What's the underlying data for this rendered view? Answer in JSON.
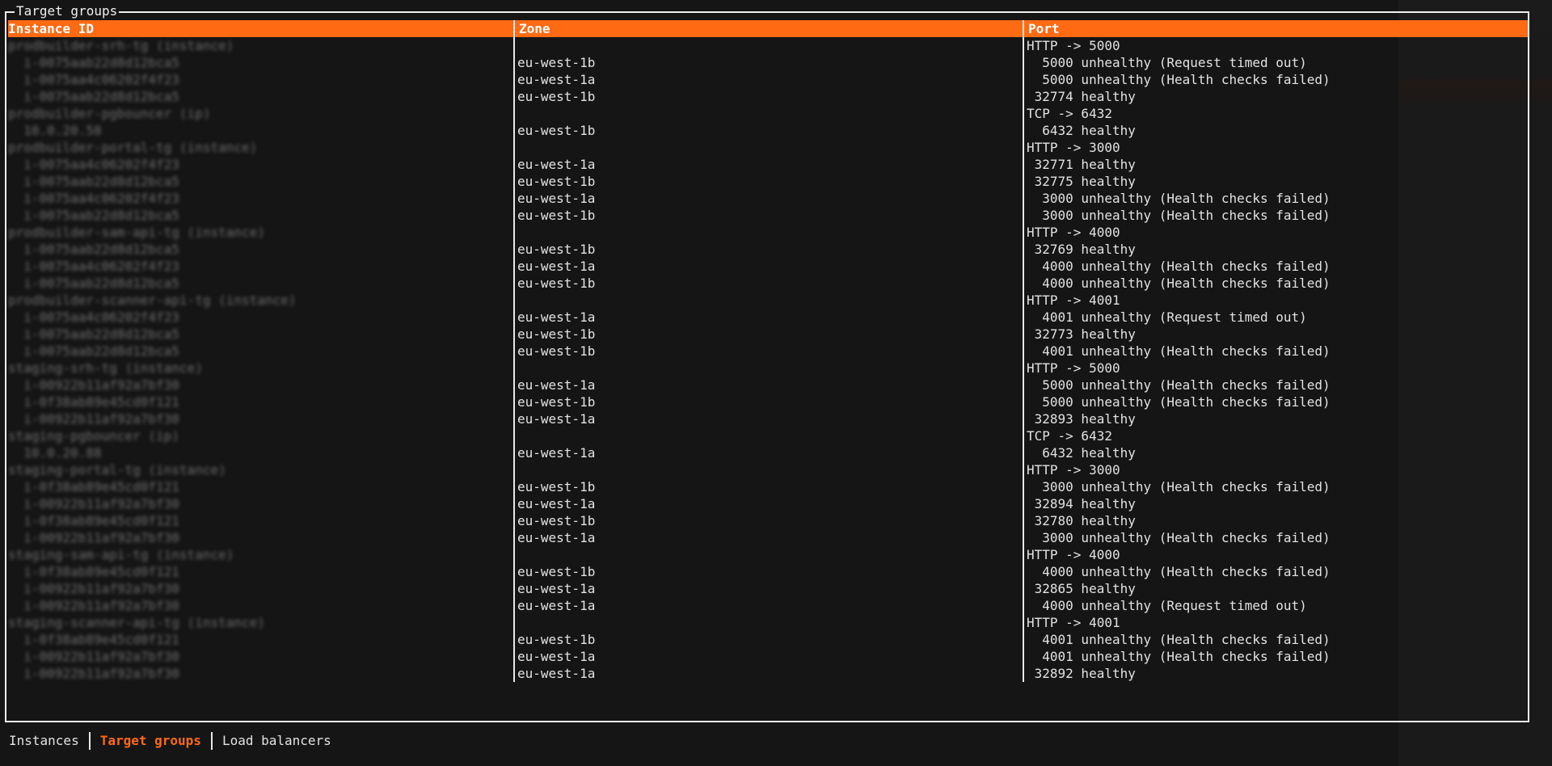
{
  "panel_title": "Target groups",
  "columns": [
    "Instance ID",
    "Zone",
    "Port"
  ],
  "rows": [
    {
      "instance": "prodbuilder-srh-tg (instance)",
      "zone": "",
      "port": "HTTP -> 5000"
    },
    {
      "instance": "  i-0075aab22d8d12bca5",
      "zone": "eu-west-1b",
      "port": "  5000 unhealthy (Request timed out)"
    },
    {
      "instance": "  i-0075aa4c06202f4f23",
      "zone": "eu-west-1a",
      "port": "  5000 unhealthy (Health checks failed)"
    },
    {
      "instance": "  i-0075aab22d8d12bca5",
      "zone": "eu-west-1b",
      "port": " 32774 healthy"
    },
    {
      "instance": "prodbuilder-pgbouncer (ip)",
      "zone": "",
      "port": "TCP -> 6432"
    },
    {
      "instance": "  10.0.20.58",
      "zone": "eu-west-1b",
      "port": "  6432 healthy"
    },
    {
      "instance": "prodbuilder-portal-tg (instance)",
      "zone": "",
      "port": "HTTP -> 3000"
    },
    {
      "instance": "  i-0075aa4c06202f4f23",
      "zone": "eu-west-1a",
      "port": " 32771 healthy"
    },
    {
      "instance": "  i-0075aab22d8d12bca5",
      "zone": "eu-west-1b",
      "port": " 32775 healthy"
    },
    {
      "instance": "  i-0075aa4c06202f4f23",
      "zone": "eu-west-1a",
      "port": "  3000 unhealthy (Health checks failed)"
    },
    {
      "instance": "  i-0075aab22d8d12bca5",
      "zone": "eu-west-1b",
      "port": "  3000 unhealthy (Health checks failed)"
    },
    {
      "instance": "prodbuilder-sam-api-tg (instance)",
      "zone": "",
      "port": "HTTP -> 4000"
    },
    {
      "instance": "  i-0075aab22d8d12bca5",
      "zone": "eu-west-1b",
      "port": " 32769 healthy"
    },
    {
      "instance": "  i-0075aa4c06202f4f23",
      "zone": "eu-west-1a",
      "port": "  4000 unhealthy (Health checks failed)"
    },
    {
      "instance": "  i-0075aab22d8d12bca5",
      "zone": "eu-west-1b",
      "port": "  4000 unhealthy (Health checks failed)"
    },
    {
      "instance": "prodbuilder-scanner-api-tg (instance)",
      "zone": "",
      "port": "HTTP -> 4001"
    },
    {
      "instance": "  i-0075aa4c06202f4f23",
      "zone": "eu-west-1a",
      "port": "  4001 unhealthy (Request timed out)"
    },
    {
      "instance": "  i-0075aab22d8d12bca5",
      "zone": "eu-west-1b",
      "port": " 32773 healthy"
    },
    {
      "instance": "  i-0075aab22d8d12bca5",
      "zone": "eu-west-1b",
      "port": "  4001 unhealthy (Health checks failed)"
    },
    {
      "instance": "staging-srh-tg (instance)",
      "zone": "",
      "port": "HTTP -> 5000"
    },
    {
      "instance": "  i-00922b11af92a7bf30",
      "zone": "eu-west-1a",
      "port": "  5000 unhealthy (Health checks failed)"
    },
    {
      "instance": "  i-0f38ab89e45cd0f121",
      "zone": "eu-west-1b",
      "port": "  5000 unhealthy (Health checks failed)"
    },
    {
      "instance": "  i-00922b11af92a7bf30",
      "zone": "eu-west-1a",
      "port": " 32893 healthy"
    },
    {
      "instance": "staging-pgbouncer (ip)",
      "zone": "",
      "port": "TCP -> 6432"
    },
    {
      "instance": "  10.0.20.88",
      "zone": "eu-west-1a",
      "port": "  6432 healthy"
    },
    {
      "instance": "staging-portal-tg (instance)",
      "zone": "",
      "port": "HTTP -> 3000"
    },
    {
      "instance": "  i-0f38ab89e45cd0f121",
      "zone": "eu-west-1b",
      "port": "  3000 unhealthy (Health checks failed)"
    },
    {
      "instance": "  i-00922b11af92a7bf30",
      "zone": "eu-west-1a",
      "port": " 32894 healthy"
    },
    {
      "instance": "  i-0f38ab89e45cd0f121",
      "zone": "eu-west-1b",
      "port": " 32780 healthy"
    },
    {
      "instance": "  i-00922b11af92a7bf30",
      "zone": "eu-west-1a",
      "port": "  3000 unhealthy (Health checks failed)"
    },
    {
      "instance": "staging-sam-api-tg (instance)",
      "zone": "",
      "port": "HTTP -> 4000"
    },
    {
      "instance": "  i-0f38ab89e45cd0f121",
      "zone": "eu-west-1b",
      "port": "  4000 unhealthy (Health checks failed)"
    },
    {
      "instance": "  i-00922b11af92a7bf30",
      "zone": "eu-west-1a",
      "port": " 32865 healthy"
    },
    {
      "instance": "  i-00922b11af92a7bf30",
      "zone": "eu-west-1a",
      "port": "  4000 unhealthy (Request timed out)"
    },
    {
      "instance": "staging-scanner-api-tg (instance)",
      "zone": "",
      "port": "HTTP -> 4001"
    },
    {
      "instance": "  i-0f38ab89e45cd0f121",
      "zone": "eu-west-1b",
      "port": "  4001 unhealthy (Health checks failed)"
    },
    {
      "instance": "  i-00922b11af92a7bf30",
      "zone": "eu-west-1a",
      "port": "  4001 unhealthy (Health checks failed)"
    },
    {
      "instance": "  i-00922b11af92a7bf30",
      "zone": "eu-west-1a",
      "port": " 32892 healthy"
    }
  ],
  "tabs": [
    {
      "label": "Instances",
      "active": false
    },
    {
      "label": "Target groups",
      "active": true
    },
    {
      "label": "Load balancers",
      "active": false
    }
  ],
  "colors": {
    "accent": "#ff6a13",
    "background": "#151515",
    "text": "#e2e2e2"
  }
}
